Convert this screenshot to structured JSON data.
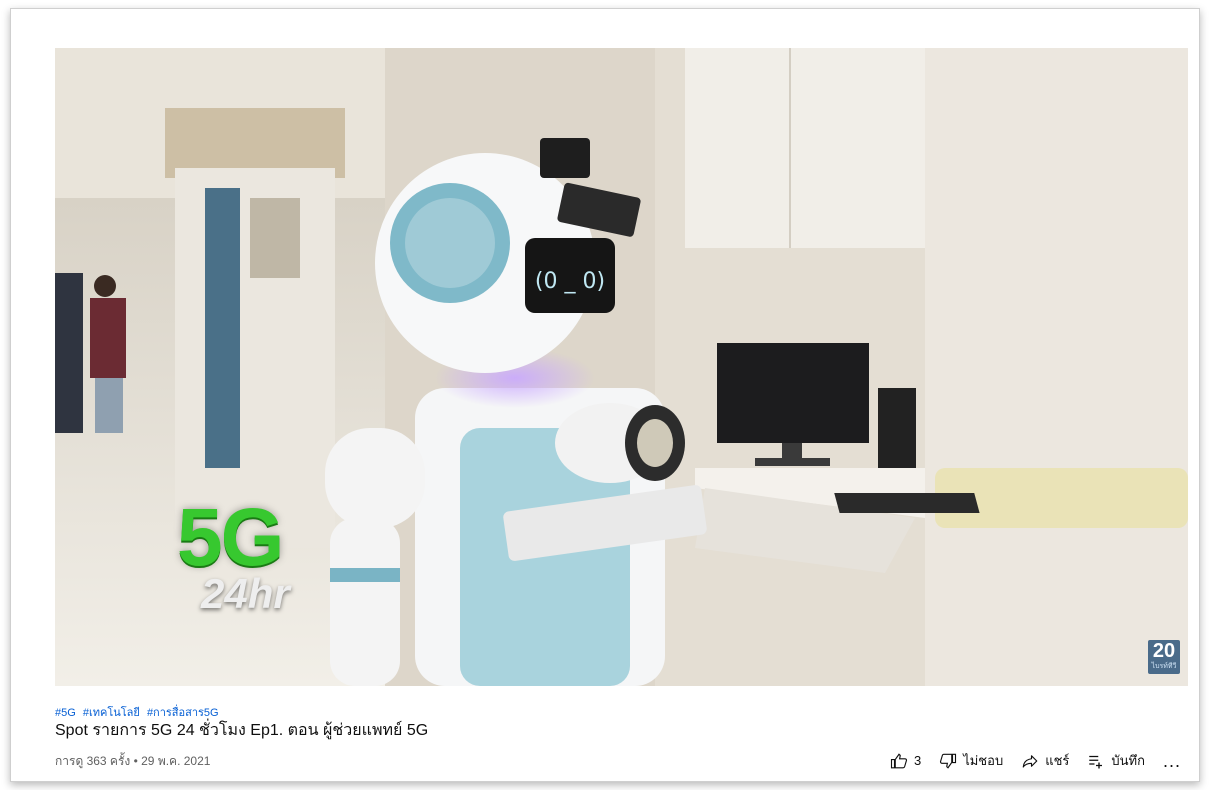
{
  "video": {
    "overlay_main": "5G",
    "overlay_sub": "24hr",
    "channel_logo_number": "20",
    "channel_logo_sub": "ไบรท์ทีวี"
  },
  "hashtags": [
    "#5G",
    "#เทคโนโลยี",
    "#การสื่อสาร5G"
  ],
  "title": "Spot รายการ 5G 24 ชั่วโมง Ep1. ตอน ผู้ช่วยแพทย์ 5G",
  "meta": "การดู 363 ครั้ง • 29 พ.ค. 2021",
  "actions": {
    "like_count": "3",
    "dislike_label": "ไม่ชอบ",
    "share_label": "แชร์",
    "save_label": "บันทึก",
    "more_label": "..."
  },
  "icons": {
    "like": "thumb-up-icon",
    "dislike": "thumb-down-icon",
    "share": "share-arrow-icon",
    "save": "playlist-add-icon",
    "more": "more-horiz-icon"
  }
}
